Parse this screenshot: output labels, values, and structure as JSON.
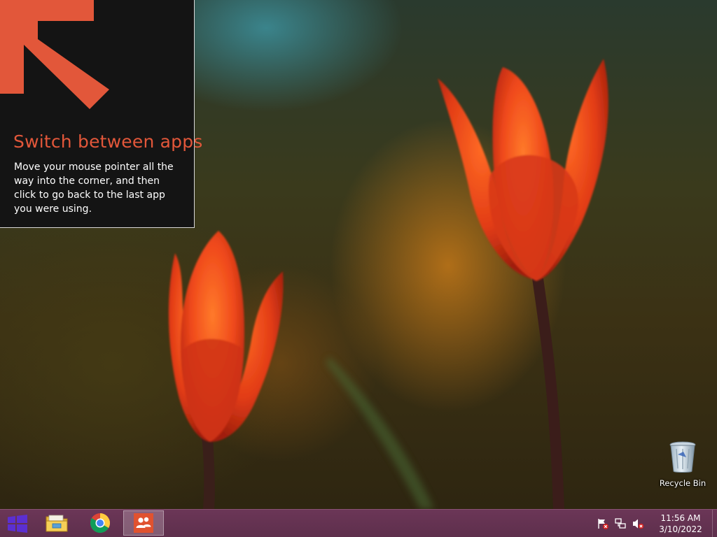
{
  "tip": {
    "title": "Switch between apps",
    "body": "Move your mouse pointer all the way into the corner, and then click to go back to the last app you were using.",
    "accent_color": "#e2573a",
    "arrow_icon": "arrow-up-left-icon"
  },
  "desktop": {
    "recycle_bin": {
      "label": "Recycle Bin",
      "icon": "recycle-bin-icon"
    }
  },
  "taskbar": {
    "color": "#6b3657",
    "start_icon": "windows-logo-icon",
    "pinned": [
      {
        "name": "File Explorer",
        "icon": "folder-icon"
      },
      {
        "name": "Google Chrome",
        "icon": "chrome-icon"
      },
      {
        "name": "People",
        "icon": "people-icon",
        "active": true
      }
    ],
    "tray": {
      "icons": [
        "action-center-flag-icon",
        "network-icon",
        "volume-muted-icon"
      ],
      "time": "11:56 AM",
      "date": "3/10/2022"
    }
  }
}
